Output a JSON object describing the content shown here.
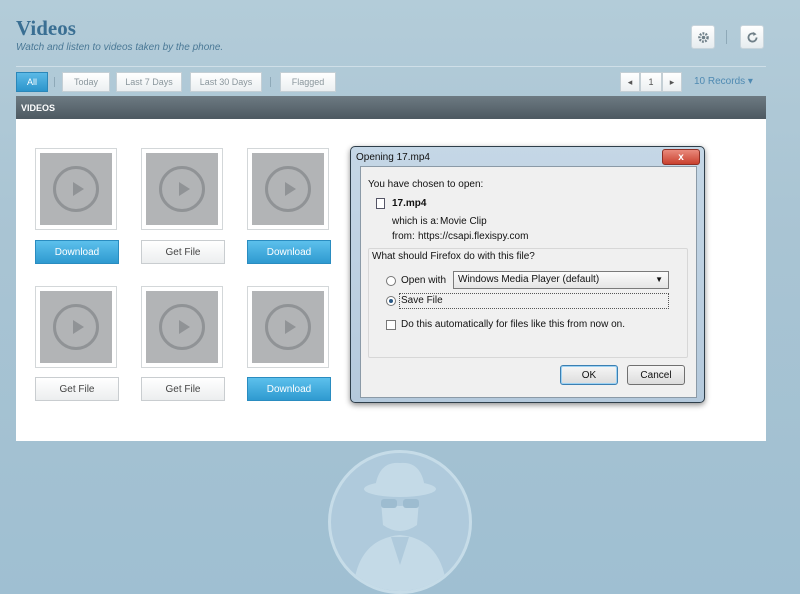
{
  "header": {
    "title": "Videos",
    "subtitle": "Watch and listen to videos taken by the phone.",
    "settings_icon": "gear-icon",
    "refresh_icon": "refresh-icon"
  },
  "filters": {
    "all": "All",
    "today": "Today",
    "last7": "Last 7 Days",
    "last30": "Last 30 Days",
    "flagged": "Flagged"
  },
  "pager": {
    "prev": "◂",
    "page": "1",
    "next": "▸",
    "records": "10 Records ▾"
  },
  "panel": {
    "heading": "VIDEOS"
  },
  "videos": [
    {
      "button": "Download",
      "kind": "download"
    },
    {
      "button": "Get File",
      "kind": "getfile"
    },
    {
      "button": "Download",
      "kind": "download"
    },
    {
      "button": "Get File",
      "kind": "getfile"
    },
    {
      "button": "Get File",
      "kind": "getfile"
    },
    {
      "button": "Download",
      "kind": "download"
    }
  ],
  "dialog": {
    "title": "Opening 17.mp4",
    "close": "x",
    "chosen_label": "You have chosen to open:",
    "filename": "17.mp4",
    "which_is_label": "which is a:",
    "which_is_value": "Movie Clip",
    "from_label": "from:",
    "from_value": "https://csapi.flexispy.com",
    "question": "What should Firefox do with this file?",
    "open_with_label": "Open with",
    "open_with_app": "Windows Media Player (default)",
    "save_file_label": "Save File",
    "auto_label": "Do this automatically for files like this from now on.",
    "ok": "OK",
    "cancel": "Cancel",
    "selected_option": "save_file"
  },
  "colors": {
    "accent": "#2f9ad0",
    "title": "#3a6f93",
    "header_bar": "#56626a"
  }
}
